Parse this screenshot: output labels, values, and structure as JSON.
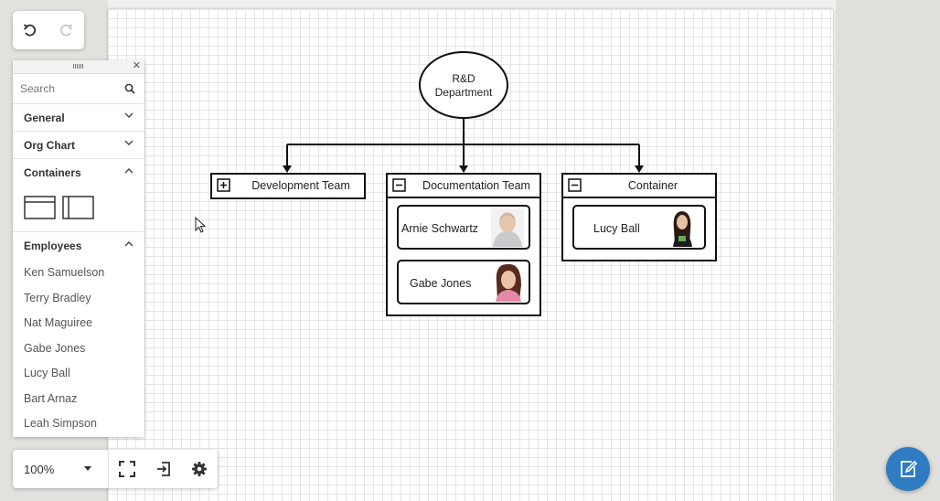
{
  "toolbar": {
    "undo_icon": "undo-icon",
    "redo_icon": "redo-icon"
  },
  "shapes_panel": {
    "search_placeholder": "Search",
    "categories": [
      {
        "label": "General",
        "expanded": false
      },
      {
        "label": "Org Chart",
        "expanded": false
      },
      {
        "label": "Containers",
        "expanded": true
      },
      {
        "label": "Employees",
        "expanded": true
      }
    ],
    "employees": [
      "Ken Samuelson",
      "Terry Bradley",
      "Nat Maguiree",
      "Gabe Jones",
      "Lucy Ball",
      "Bart Arnaz",
      "Leah Simpson"
    ]
  },
  "diagram": {
    "root": {
      "line1": "R&D",
      "line2": "Department"
    },
    "containers": [
      {
        "title": "Development Team",
        "collapsed": true,
        "members": []
      },
      {
        "title": "Documentation Team",
        "collapsed": false,
        "members": [
          "Arnie Schwartz",
          "Gabe Jones"
        ]
      },
      {
        "title": "Container",
        "collapsed": false,
        "members": [
          "Lucy Ball"
        ]
      }
    ]
  },
  "zoom_bar": {
    "zoom": "100%"
  },
  "colors": {
    "accent": "#2f7cc3",
    "canvas": "#ffffff",
    "background": "#e1e2de"
  }
}
